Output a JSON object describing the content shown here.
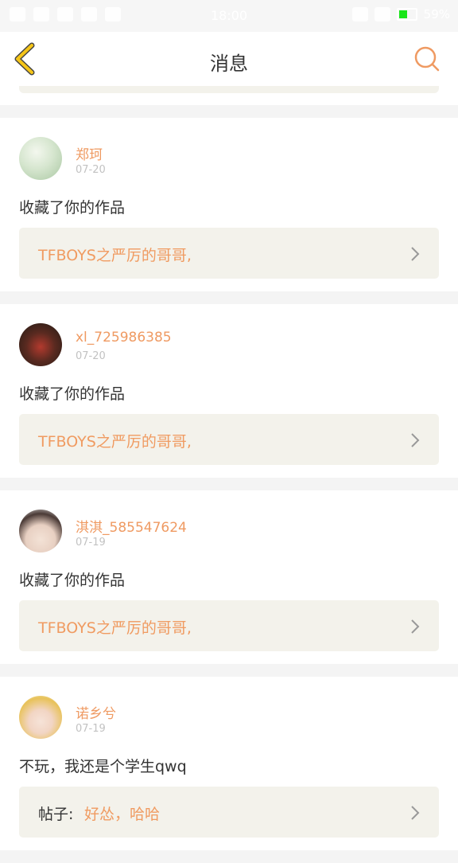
{
  "status_bar": {
    "time": "18:00",
    "battery": "59%",
    "battery_level": 0.59,
    "battery_color": "#19e619"
  },
  "header": {
    "title": "消息",
    "back_icon": "chevron-left-icon",
    "search_icon": "search-icon",
    "back_color": "#f5c518",
    "search_color": "#ef9a62"
  },
  "messages": [
    {
      "username": "郑珂",
      "date": "07-20",
      "text": "收藏了你的作品",
      "ref_label": "",
      "ref_text": "TFBOYS之严厉的哥哥,"
    },
    {
      "username": "xl_725986385",
      "date": "07-20",
      "text": "收藏了你的作品",
      "ref_label": "",
      "ref_text": "TFBOYS之严厉的哥哥,"
    },
    {
      "username": "淇淇_585547624",
      "date": "07-19",
      "text": "收藏了你的作品",
      "ref_label": "",
      "ref_text": "TFBOYS之严厉的哥哥,"
    },
    {
      "username": "诺乡兮",
      "date": "07-19",
      "text": "不玩，我还是个学生qwq",
      "ref_label": "帖子:",
      "ref_text": "好怂，哈哈"
    }
  ],
  "colors": {
    "accent": "#ef9a62",
    "ref_bg": "#f3f2eb",
    "page_bg": "#f4f4f4"
  }
}
